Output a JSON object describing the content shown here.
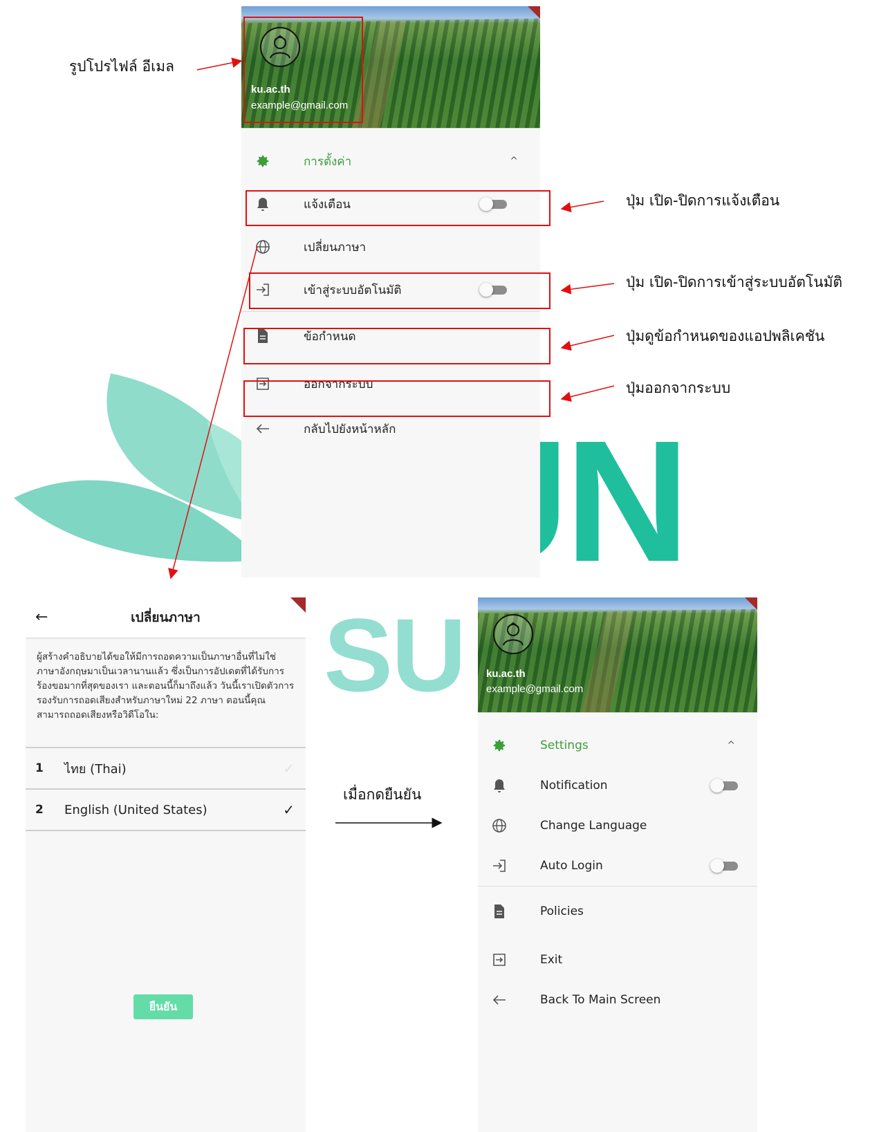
{
  "annotations": {
    "profile": "รูปโปรไฟล์ อีเมล",
    "notification_toggle": "ปุ่ม เปิด-ปิดการแจ้งเตือน",
    "autologin_toggle": "ปุ่ม เปิด-ปิดการเข้าสู่ระบบอัตโนมัติ",
    "policies": "ปุ่มดูข้อกำหนดของแอปพลิเคชัน",
    "exit": "ปุ่มออกจากระบบ",
    "after_confirm": "เมื่อกดยืนยัน"
  },
  "drawer_thai": {
    "profile_name": "ku.ac.th",
    "profile_email": "example@gmail.com",
    "settings_label": "การตั้งค่า",
    "notification_label": "แจ้งเตือน",
    "notification_on": false,
    "language_label": "เปลี่ยนภาษา",
    "autologin_label": "เข้าสู่ระบบอัตโนมัติ",
    "autologin_on": false,
    "policies_label": "ข้อกำหนด",
    "exit_label": "ออกจากระบบ",
    "back_label": "กลับไปยังหน้าหลัก"
  },
  "language_screen": {
    "title": "เปลี่ยนภาษา",
    "description": "ผู้สร้างคำอธิบายได้ขอให้มีการถอดความเป็นภาษาอื่นที่ไม่ใช่ภาษาอังกฤษมาเป็นเวลานานแล้ว ซึ่งเป็นการอัปเดตที่ได้รับการร้องขอมากที่สุดของเรา และตอนนี้ก็มาถึงแล้ว วันนี้เราเปิดตัวการรองรับการถอดเสียงสำหรับภาษาใหม่ 22 ภาษา ตอนนี้คุณสามารถถอดเสียงหรือวิดีโอใน:",
    "languages": [
      {
        "num": "1",
        "name": "ไทย (Thai)",
        "selected": false
      },
      {
        "num": "2",
        "name": "English (United States)",
        "selected": true
      }
    ],
    "check": "✓",
    "confirm_label": "ยืนยัน"
  },
  "drawer_english": {
    "profile_name": "ku.ac.th",
    "profile_email": "example@gmail.com",
    "settings_label": "Settings",
    "notification_label": "Notification",
    "notification_on": false,
    "language_label": "Change Language",
    "autologin_label": "Auto Login",
    "autologin_on": false,
    "policies_label": "Policies",
    "exit_label": "Exit",
    "back_label": "Back To Main Screen"
  },
  "icons": [
    "gear-icon",
    "bell-icon",
    "globe-icon",
    "login-icon",
    "document-icon",
    "exit-icon",
    "arrow-left-icon",
    "chevron-up-icon",
    "check-icon",
    "user-avatar-icon"
  ],
  "colors": {
    "accent_green": "#3a9e3a",
    "confirm_button": "#64dca8",
    "annotation_red": "#e01010",
    "watermark_teal": "#1fbf9d"
  }
}
